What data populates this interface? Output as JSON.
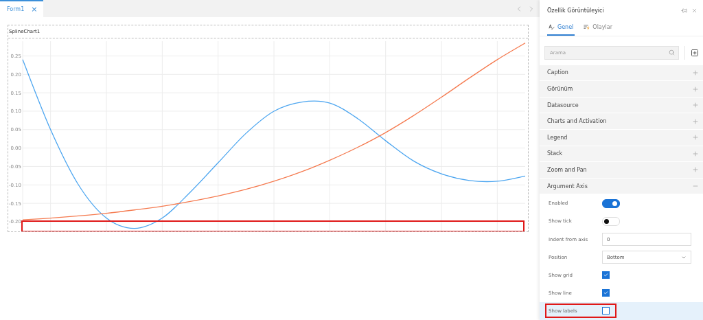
{
  "tabs": [
    {
      "label": "Form1",
      "selected": true,
      "close": "×"
    }
  ],
  "chart": {
    "title": "SplineChart1",
    "highlighted": true,
    "chart_data": {
      "type": "line",
      "grid": true,
      "ylim": [
        -0.23,
        0.29
      ],
      "yticks": [
        {
          "value": 0.25,
          "label": "0.25"
        },
        {
          "value": 0.2,
          "label": "0.20"
        },
        {
          "value": 0.15,
          "label": "0.15"
        },
        {
          "value": 0.1,
          "label": "0.10"
        },
        {
          "value": 0.05,
          "label": "0.05"
        },
        {
          "value": 0,
          "label": "0.00"
        },
        {
          "value": -0.05,
          "label": "-0.05"
        },
        {
          "value": -0.1,
          "label": "-0.10"
        },
        {
          "value": -0.15,
          "label": "-0.15"
        },
        {
          "value": -0.2,
          "label": "-0.20"
        }
      ],
      "series": [
        {
          "color": "#4da6f0",
          "values": [
            0.24,
            0.05,
            -0.1,
            -0.19,
            -0.218,
            -0.19,
            -0.12,
            -0.04,
            0.04,
            0.1,
            0.125,
            0.122,
            0.08,
            0.02,
            -0.035,
            -0.07,
            -0.088,
            -0.09,
            -0.076
          ]
        },
        {
          "color": "#f57a4f",
          "values": [
            -0.195,
            -0.19,
            -0.184,
            -0.177,
            -0.168,
            -0.158,
            -0.145,
            -0.13,
            -0.112,
            -0.09,
            -0.064,
            -0.033,
            0.002,
            0.042,
            0.088,
            0.138,
            0.19,
            0.24,
            0.285
          ]
        }
      ]
    }
  },
  "panel": {
    "title": "Özellik Görüntüleyici",
    "tabs": [
      {
        "label": "Genel",
        "selected": true
      },
      {
        "label": "Olaylar",
        "selected": false
      }
    ],
    "search": {
      "placeholder": "Arama"
    },
    "sections": [
      {
        "label": "Caption",
        "expanded": false
      },
      {
        "label": "Görünüm",
        "expanded": false
      },
      {
        "label": "Datasource",
        "expanded": false
      },
      {
        "label": "Charts and Activation",
        "expanded": false
      },
      {
        "label": "Legend",
        "expanded": false
      },
      {
        "label": "Stack",
        "expanded": false
      },
      {
        "label": "Zoom and Pan",
        "expanded": false
      },
      {
        "label": "Argument Axis",
        "expanded": true,
        "properties": [
          {
            "label": "Enabled",
            "kind": "toggle",
            "on": true,
            "selected": false,
            "highlighted": false
          },
          {
            "label": "Show tick",
            "kind": "toggle",
            "on": false,
            "selected": false,
            "highlighted": false
          },
          {
            "label": "Indent from axis",
            "kind": "input",
            "value": "0",
            "selected": false,
            "highlighted": false
          },
          {
            "label": "Position",
            "kind": "select",
            "value": "Bottom",
            "selected": false,
            "highlighted": false
          },
          {
            "label": "Show grid",
            "kind": "checkbox",
            "checked": true,
            "selected": false,
            "highlighted": false
          },
          {
            "label": "Show line",
            "kind": "checkbox",
            "checked": true,
            "selected": false,
            "highlighted": false
          },
          {
            "label": "Show labels",
            "kind": "checkbox",
            "checked": false,
            "selected": true,
            "highlighted": true
          }
        ]
      }
    ]
  }
}
